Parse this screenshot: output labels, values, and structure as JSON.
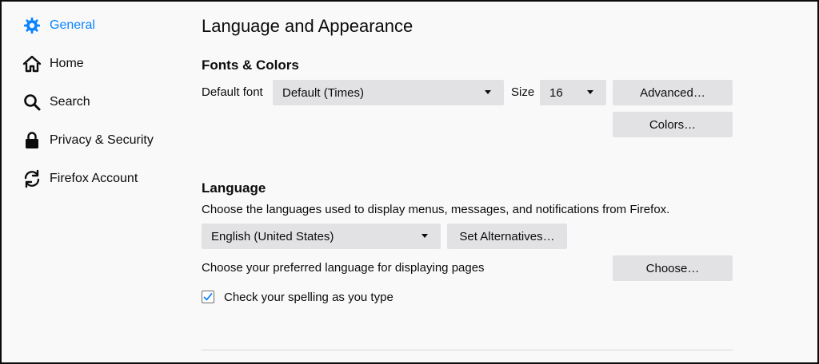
{
  "sidebar": {
    "items": [
      {
        "label": "General",
        "icon": "gear-icon",
        "active": true
      },
      {
        "label": "Home",
        "icon": "home-icon"
      },
      {
        "label": "Search",
        "icon": "search-icon"
      },
      {
        "label": "Privacy & Security",
        "icon": "lock-icon"
      },
      {
        "label": "Firefox Account",
        "icon": "sync-icon"
      }
    ]
  },
  "main": {
    "title": "Language and Appearance",
    "fonts_colors": {
      "heading": "Fonts & Colors",
      "default_font_label": "Default font",
      "default_font_value": "Default (Times)",
      "size_label": "Size",
      "size_value": "16",
      "advanced_button": "Advanced…",
      "colors_button": "Colors…"
    },
    "language": {
      "heading": "Language",
      "description": "Choose the languages used to display menus, messages, and notifications from Firefox.",
      "language_value": "English (United States)",
      "set_alternatives_button": "Set Alternatives…",
      "pages_description": "Choose your preferred language for displaying pages",
      "choose_button": "Choose…",
      "spellcheck_label": "Check your spelling as you type",
      "spellcheck_checked": true
    }
  },
  "colors": {
    "accent": "#0a84ff",
    "button_bg": "#e2e2e5",
    "page_bg": "#f9f9fa"
  }
}
